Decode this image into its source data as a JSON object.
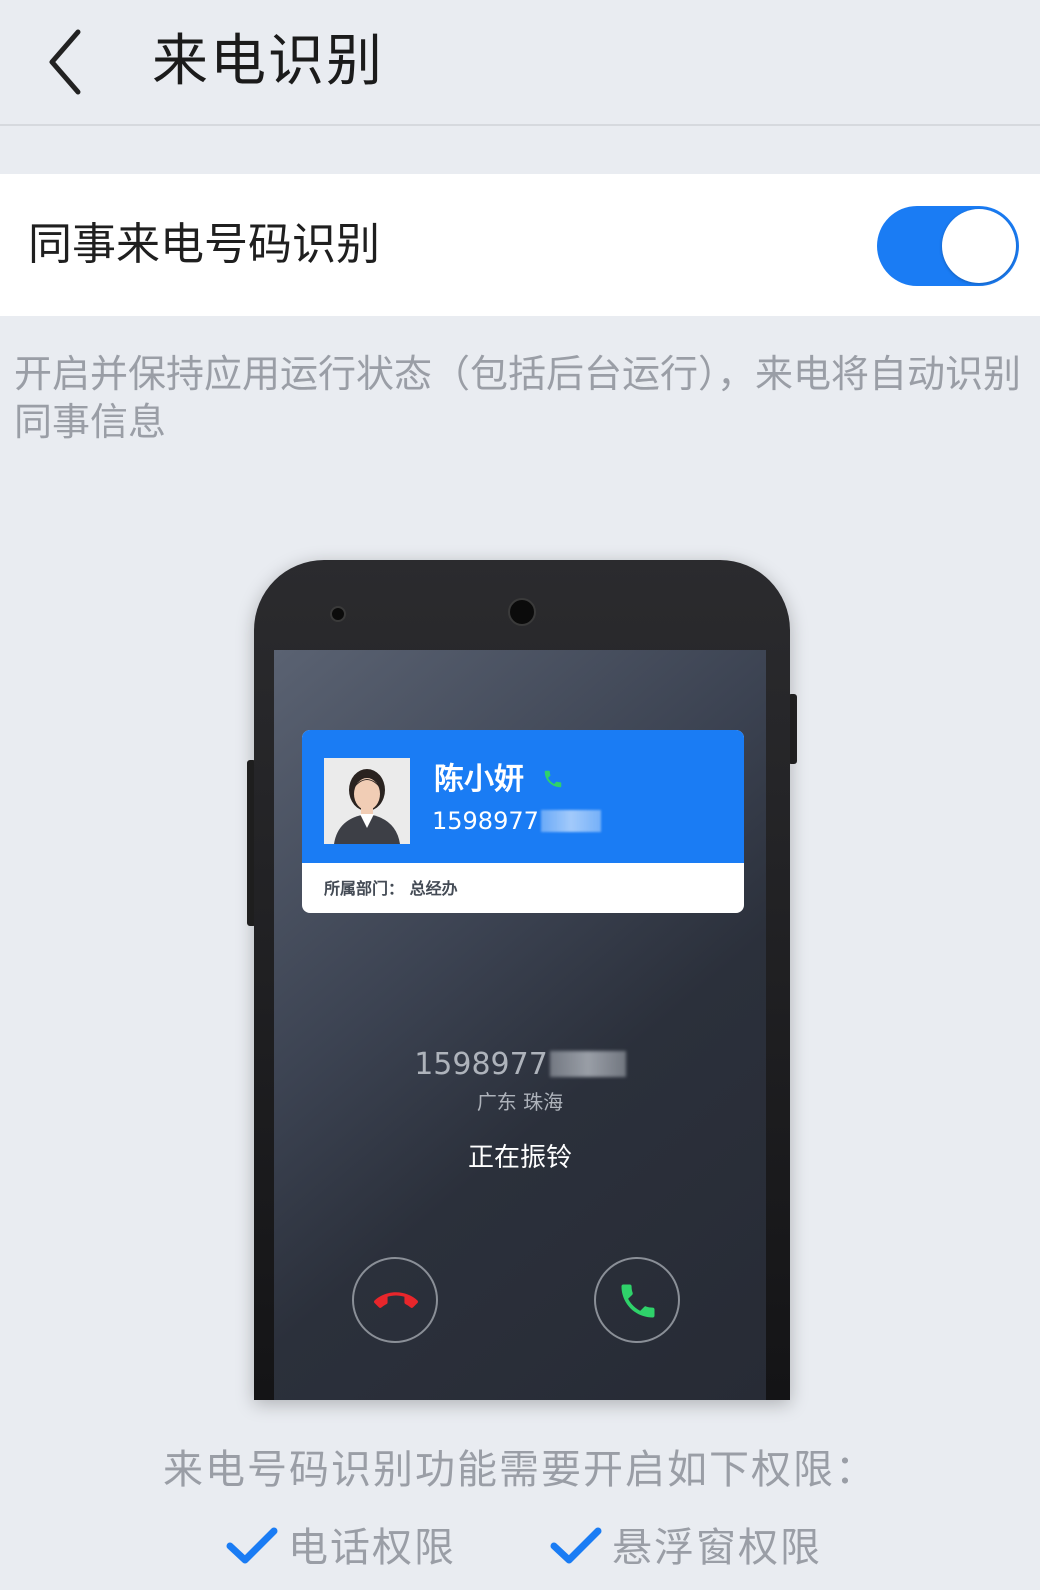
{
  "header": {
    "title": "来电识别",
    "back_icon": "chevron-left-icon"
  },
  "setting": {
    "label": "同事来电号码识别",
    "toggle_on": true,
    "accent_color": "#1a7cf4"
  },
  "description": "开启并保持应用运行状态（包括后台运行），来电将自动识别同事信息",
  "illustration": {
    "card": {
      "name": "陈小妍",
      "number": "1598977",
      "department": "所属部门：  总经办"
    },
    "caller_number": "1598977",
    "caller_location": "广东  珠海",
    "status": "正在振铃"
  },
  "permissions": {
    "title": "来电号码识别功能需要开启如下权限：",
    "items": [
      {
        "label": "电话权限",
        "icon": "checkmark-icon"
      },
      {
        "label": "悬浮窗权限",
        "icon": "checkmark-icon"
      }
    ]
  }
}
